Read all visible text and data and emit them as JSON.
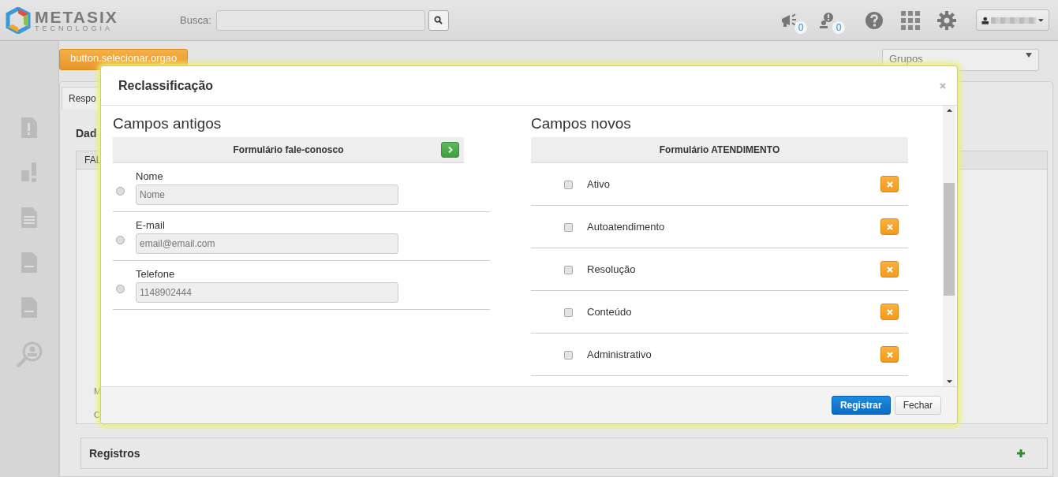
{
  "header": {
    "logo": {
      "name": "METASIX",
      "tagline": "TECNOLOGIA"
    },
    "search": {
      "label": "Busca:"
    },
    "notifications": [
      {
        "kind": "megaphone",
        "count": "0"
      },
      {
        "kind": "alert",
        "count": "0"
      }
    ]
  },
  "background": {
    "select_button": "button.selecionar.orgao",
    "groups_select": "Grupos",
    "tab": "Respo",
    "section_title": "Dad",
    "column_1": "FAL",
    "labels": [
      "M",
      "C"
    ],
    "records_panel": "Registros"
  },
  "modal": {
    "title": "Reclassificação",
    "old_fields": {
      "title": "Campos antigos",
      "form": "Formulário fale-conosco",
      "fields": [
        {
          "label": "Nome",
          "value": "Nome",
          "selected": false
        },
        {
          "label": "E-mail",
          "value": "email@email.com",
          "selected": false
        },
        {
          "label": "Telefone",
          "value": "1148902444",
          "selected": false
        }
      ]
    },
    "new_fields": {
      "title": "Campos novos",
      "form": "Formulário ATENDIMENTO",
      "fields": [
        {
          "label": "Ativo",
          "checked": false
        },
        {
          "label": "Autoatendimento",
          "checked": false
        },
        {
          "label": "Resolução",
          "checked": false
        },
        {
          "label": "Conteúdo",
          "checked": false
        },
        {
          "label": "Administrativo",
          "checked": false
        }
      ]
    },
    "buttons": [
      {
        "label": "Registrar",
        "kind": "primary"
      },
      {
        "label": "Fechar",
        "kind": "default"
      }
    ]
  }
}
